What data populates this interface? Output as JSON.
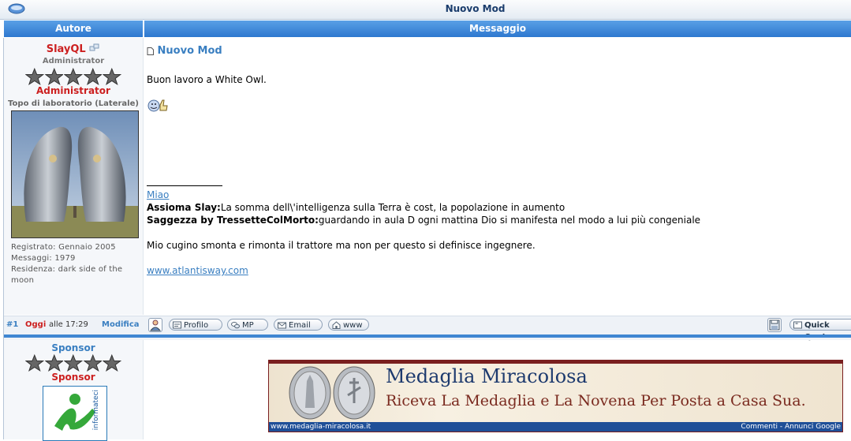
{
  "window": {
    "title": "Nuovo Mod"
  },
  "header": {
    "author_label": "Autore",
    "message_label": "Messaggio"
  },
  "post": {
    "author": {
      "name": "SlayQL",
      "role": "Administrator",
      "rank": "Administrator",
      "custom_title": "Topo di laboratorio (Laterale)",
      "registered": "Registrato: Gennaio 2005",
      "messages": "Messaggi: 1979",
      "residence_line1": "Residenza: dark side of the",
      "residence_line2": "moon"
    },
    "title": "Nuovo Mod",
    "body": "Buon lavoro a White Owl.",
    "signature": {
      "link_miao": "Miao",
      "slay_label": "Assioma Slay:",
      "slay_text": "La somma dell\\'intelligenza sulla Terra è cost, la popolazione in aumento",
      "saggezza_label": "Saggezza by TressetteColMorto:",
      "saggezza_text": "guardando in aula D ogni mattina Dio si manifesta nel modo a lui più congeniale",
      "cousin": "Mio cugino smonta e rimonta il trattore ma non per questo si definisce ingegnere.",
      "website": "www.atlantisway.com"
    },
    "footer": {
      "number": "#1",
      "day": "Oggi",
      "time": "alle 17:29",
      "edit": "Modifica",
      "profile": "Profilo",
      "mp": "MP",
      "email": "Email",
      "www": "www",
      "quick_quote": "Quick Quote"
    }
  },
  "sponsor": {
    "name": "Sponsor",
    "rank": "Sponsor",
    "logo_text": "informateci",
    "ad": {
      "title": "Medaglia Miracolosa",
      "subtitle": "Riceva La Medaglia e La Novena Per Posta a Casa Sua.",
      "url": "www.medaglia-miracolosa.it",
      "google": "Commenti - Annunci Google"
    }
  },
  "colors": {
    "header_blue": "#2e78cf",
    "username_red": "#cc1f1f",
    "link_blue": "#3a7fc1",
    "ad_maroon": "#7a1f1f"
  }
}
